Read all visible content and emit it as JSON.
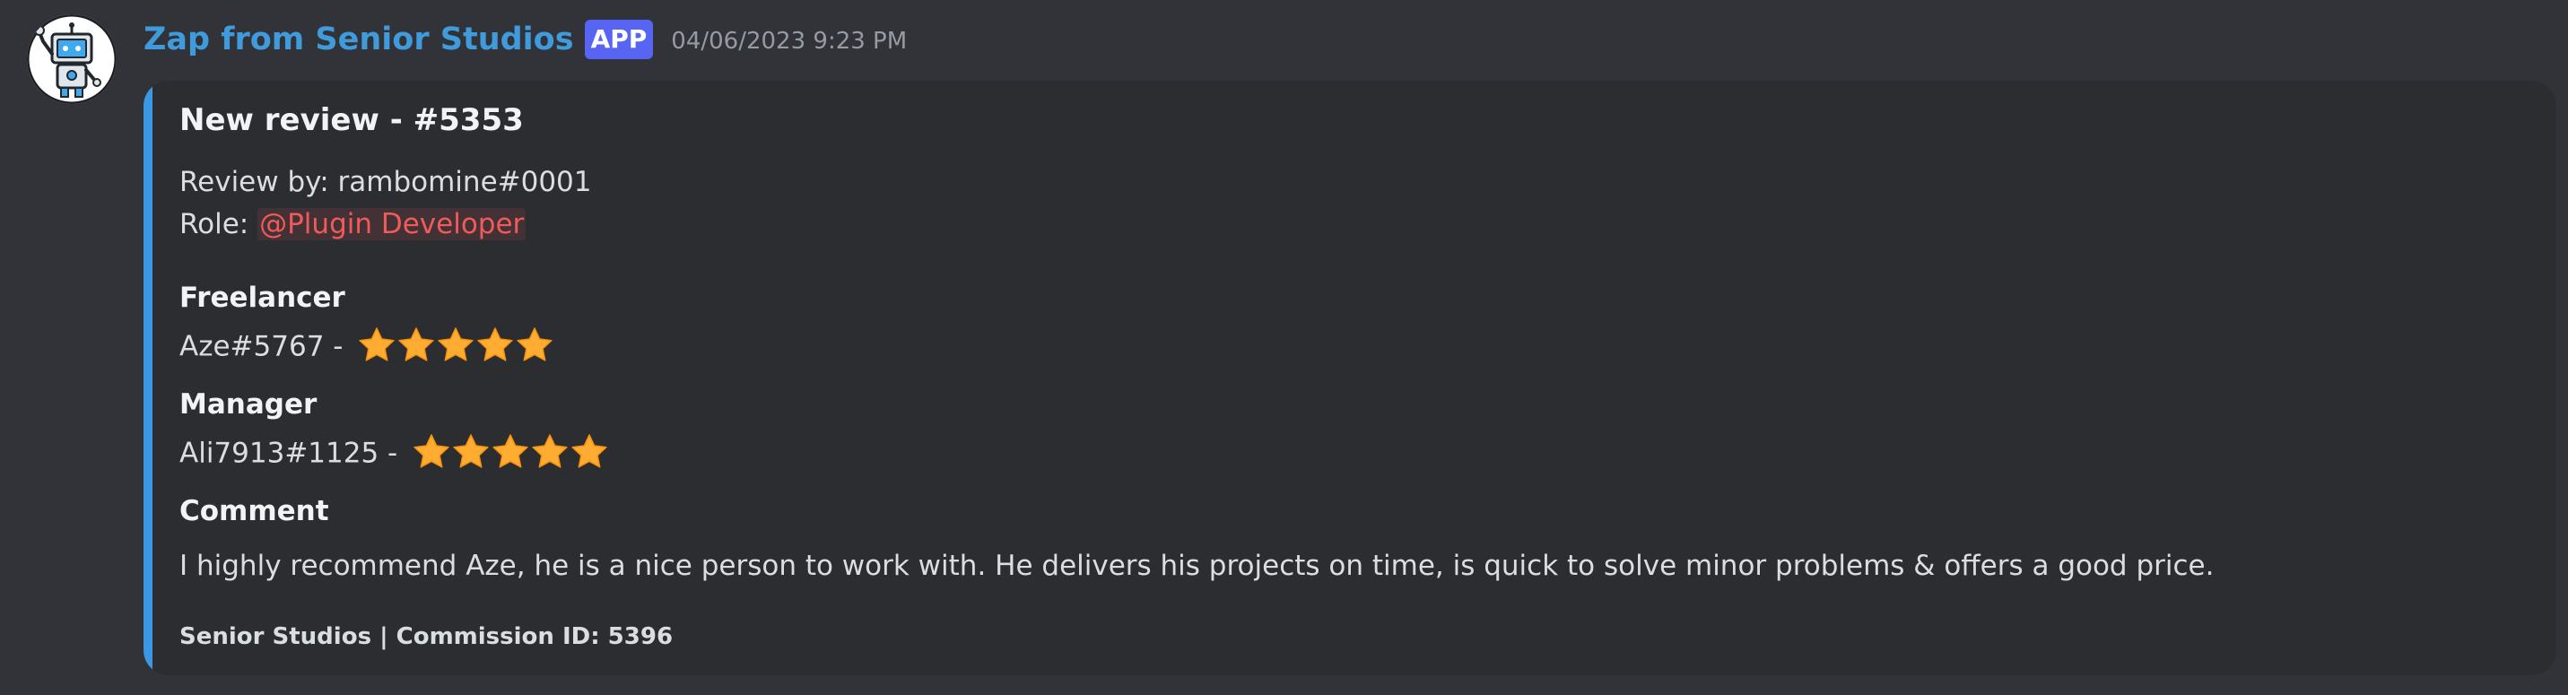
{
  "message": {
    "author": "Zap from Senior Studios",
    "badge": "APP",
    "timestamp": "04/06/2023 9:23 PM"
  },
  "embed": {
    "accent_color": "#3b97e2",
    "title": "New review - #5353",
    "review_by_label": "Review by: rambomine#0001",
    "role_label": "Role: ",
    "role_mention": "@Plugin Developer",
    "role_color": "#f05a5a",
    "fields": [
      {
        "name": "Freelancer",
        "value": "Aze#5767 - ",
        "rating": 5
      },
      {
        "name": "Manager",
        "value": "Ali7913#1125 - ",
        "rating": 5
      },
      {
        "name": "Comment",
        "value": "I highly recommend Aze, he is a nice person to work with. He delivers his projects on time, is quick to solve minor problems & offers a good price."
      }
    ],
    "footer": "Senior Studios | Commission ID: 5396",
    "star_icon": "star-icon",
    "star_color": "#ffac33"
  }
}
